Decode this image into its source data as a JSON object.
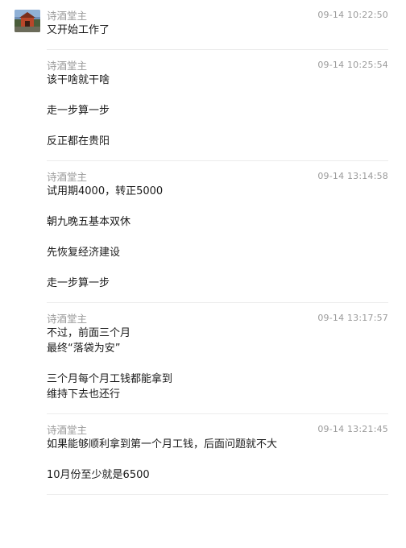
{
  "messages": [
    {
      "sender": "诗酒堂主",
      "time": "09-14 10:22:50",
      "has_avatar": true,
      "paragraphs": [
        "又开始工作了"
      ]
    },
    {
      "sender": "诗酒堂主",
      "time": "09-14 10:25:54",
      "paragraphs": [
        "该干啥就干啥",
        "走一步算一步",
        "反正都在贵阳"
      ]
    },
    {
      "sender": "诗酒堂主",
      "time": "09-14 13:14:58",
      "paragraphs": [
        "试用期4000，转正5000",
        "朝九晚五基本双休",
        "先恢复经济建设",
        "走一步算一步"
      ]
    },
    {
      "sender": "诗酒堂主",
      "time": "09-14 13:17:57",
      "paragraphs": [
        "不过，前面三个月\n最终“落袋为安”",
        "三个月每个月工钱都能拿到\n维持下去也还行"
      ]
    },
    {
      "sender": "诗酒堂主",
      "time": "09-14 13:21:45",
      "paragraphs": [
        "如果能够顺利拿到第一个月工钱，后面问题就不大",
        "10月份至少就是6500"
      ]
    }
  ]
}
